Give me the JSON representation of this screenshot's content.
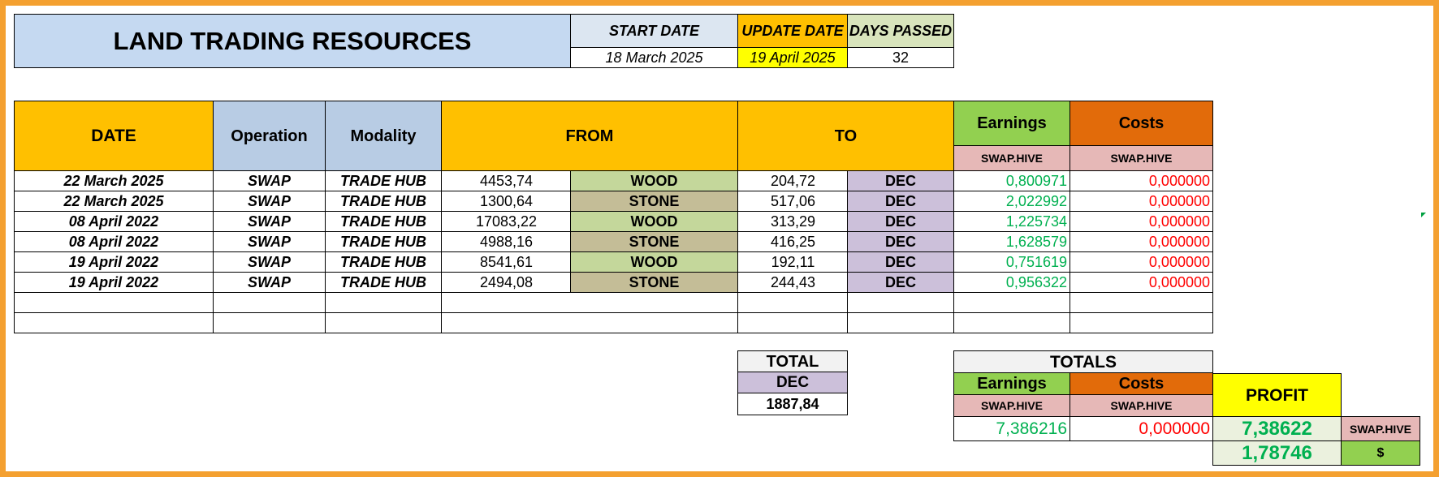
{
  "header": {
    "title": "LAND TRADING RESOURCES",
    "start_date_label": "START DATE",
    "start_date": "18 March 2025",
    "update_date_label": "UPDATE DATE",
    "update_date": "19 April 2025",
    "days_passed_label": "DAYS PASSED",
    "days_passed": "32"
  },
  "columns": {
    "date": "DATE",
    "operation": "Operation",
    "modality": "Modality",
    "from": "FROM",
    "to": "TO",
    "earnings": "Earnings",
    "costs": "Costs",
    "earnings_unit": "SWAP.HIVE",
    "costs_unit": "SWAP.HIVE"
  },
  "rows": [
    {
      "date": "22 March 2025",
      "operation": "SWAP",
      "modality": "TRADE HUB",
      "from_amount": "4453,74",
      "from_resource": "WOOD",
      "to_amount": "204,72",
      "to_resource": "DEC",
      "earnings": "0,800971",
      "costs": "0,000000"
    },
    {
      "date": "22 March 2025",
      "operation": "SWAP",
      "modality": "TRADE HUB",
      "from_amount": "1300,64",
      "from_resource": "STONE",
      "to_amount": "517,06",
      "to_resource": "DEC",
      "earnings": "2,022992",
      "costs": "0,000000"
    },
    {
      "date": "08 April 2022",
      "operation": "SWAP",
      "modality": "TRADE HUB",
      "from_amount": "17083,22",
      "from_resource": "WOOD",
      "to_amount": "313,29",
      "to_resource": "DEC",
      "earnings": "1,225734",
      "costs": "0,000000"
    },
    {
      "date": "08 April 2022",
      "operation": "SWAP",
      "modality": "TRADE HUB",
      "from_amount": "4988,16",
      "from_resource": "STONE",
      "to_amount": "416,25",
      "to_resource": "DEC",
      "earnings": "1,628579",
      "costs": "0,000000"
    },
    {
      "date": "19 April 2022",
      "operation": "SWAP",
      "modality": "TRADE HUB",
      "from_amount": "8541,61",
      "from_resource": "WOOD",
      "to_amount": "192,11",
      "to_resource": "DEC",
      "earnings": "0,751619",
      "costs": "0,000000"
    },
    {
      "date": "19 April 2022",
      "operation": "SWAP",
      "modality": "TRADE HUB",
      "from_amount": "2494,08",
      "from_resource": "STONE",
      "to_amount": "244,43",
      "to_resource": "DEC",
      "earnings": "0,956322",
      "costs": "0,000000"
    }
  ],
  "total": {
    "label": "TOTAL",
    "unit": "DEC",
    "value": "1887,84"
  },
  "totals": {
    "label": "TOTALS",
    "earnings_label": "Earnings",
    "costs_label": "Costs",
    "earnings_unit": "SWAP.HIVE",
    "costs_unit": "SWAP.HIVE",
    "earnings": "7,386216",
    "costs": "0,000000",
    "profit_label": "PROFIT",
    "profit_hive": "7,38622",
    "profit_hive_unit": "SWAP.HIVE",
    "profit_usd": "1,78746",
    "profit_usd_unit": "$"
  },
  "colors": {
    "title_bg": "#c5d9f1",
    "start_bg": "#dce6f1",
    "update_bg": "#ffc000",
    "update_value_bg": "#ffff00",
    "days_bg": "#d8e4bc",
    "date_header_bg": "#ffc000",
    "op_header_bg": "#b8cce4",
    "earnings_bg": "#92d050",
    "costs_bg": "#e26b0a",
    "unit_bg": "#e6b8b7",
    "wood_bg": "#c4d79b",
    "stone_bg": "#c4bd97",
    "dec_bg": "#ccc0da",
    "profit_bg": "#ffff00",
    "profit_value_bg": "#ebf1de",
    "usd_bg": "#92d050"
  }
}
